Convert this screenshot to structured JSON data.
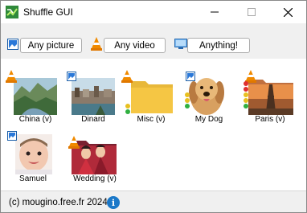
{
  "window": {
    "title": "Shuffle GUI"
  },
  "toolbar": {
    "picture_label": "Any picture",
    "video_label": "Any video",
    "anything_label": "Anything!"
  },
  "items": [
    {
      "label": "China (v)",
      "badge": "vlc-cone-icon"
    },
    {
      "label": "Dinard",
      "badge": "picture-icon"
    },
    {
      "label": "Misc (v)",
      "badge": "vlc-cone-icon"
    },
    {
      "label": "My Dog",
      "badge": "picture-icon"
    },
    {
      "label": "Paris (v)",
      "badge": "vlc-cone-icon"
    },
    {
      "label": "Samuel",
      "badge": "picture-icon"
    },
    {
      "label": "Wedding (v)",
      "badge": "vlc-cone-icon"
    }
  ],
  "status": {
    "text": "(c) mougino.free.fr 2024"
  },
  "colors": {
    "folder": "#f5c644",
    "accent": "#1a78c8",
    "vlc_orange": "#f08a00"
  }
}
